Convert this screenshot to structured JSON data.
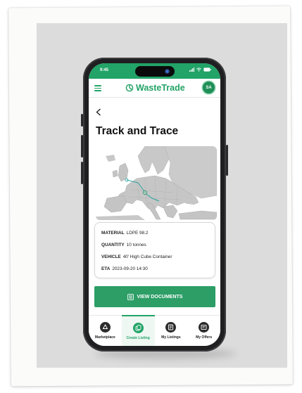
{
  "status": {
    "time": "9:45"
  },
  "header": {
    "brand": "WasteTrade",
    "avatar_initials": "SA"
  },
  "page": {
    "title": "Track and Trace"
  },
  "shipment": {
    "material_label": "MATERIAL",
    "material_value": "LDPE 98.2",
    "quantity_label": "QUANTITY",
    "quantity_value": "10 tonnes",
    "vehicle_label": "VEHICLE",
    "vehicle_value": "40' High Cube Container",
    "eta_label": "ETA",
    "eta_value": "2023-09-20 14:30"
  },
  "actions": {
    "view_documents": "VIEW DOCUMENTS"
  },
  "nav": {
    "items": [
      {
        "label": "Marketplace",
        "icon": "recycle-icon"
      },
      {
        "label": "Create Listing",
        "icon": "listing-add-icon"
      },
      {
        "label": "My Listings",
        "icon": "listings-icon"
      },
      {
        "label": "My Offers",
        "icon": "offers-icon"
      }
    ],
    "active": "Create Listing"
  },
  "colors": {
    "brand_green": "#22a367",
    "button_green": "#2c9e66",
    "map_land": "#c8c8c8",
    "route": "#2aa6a0"
  }
}
